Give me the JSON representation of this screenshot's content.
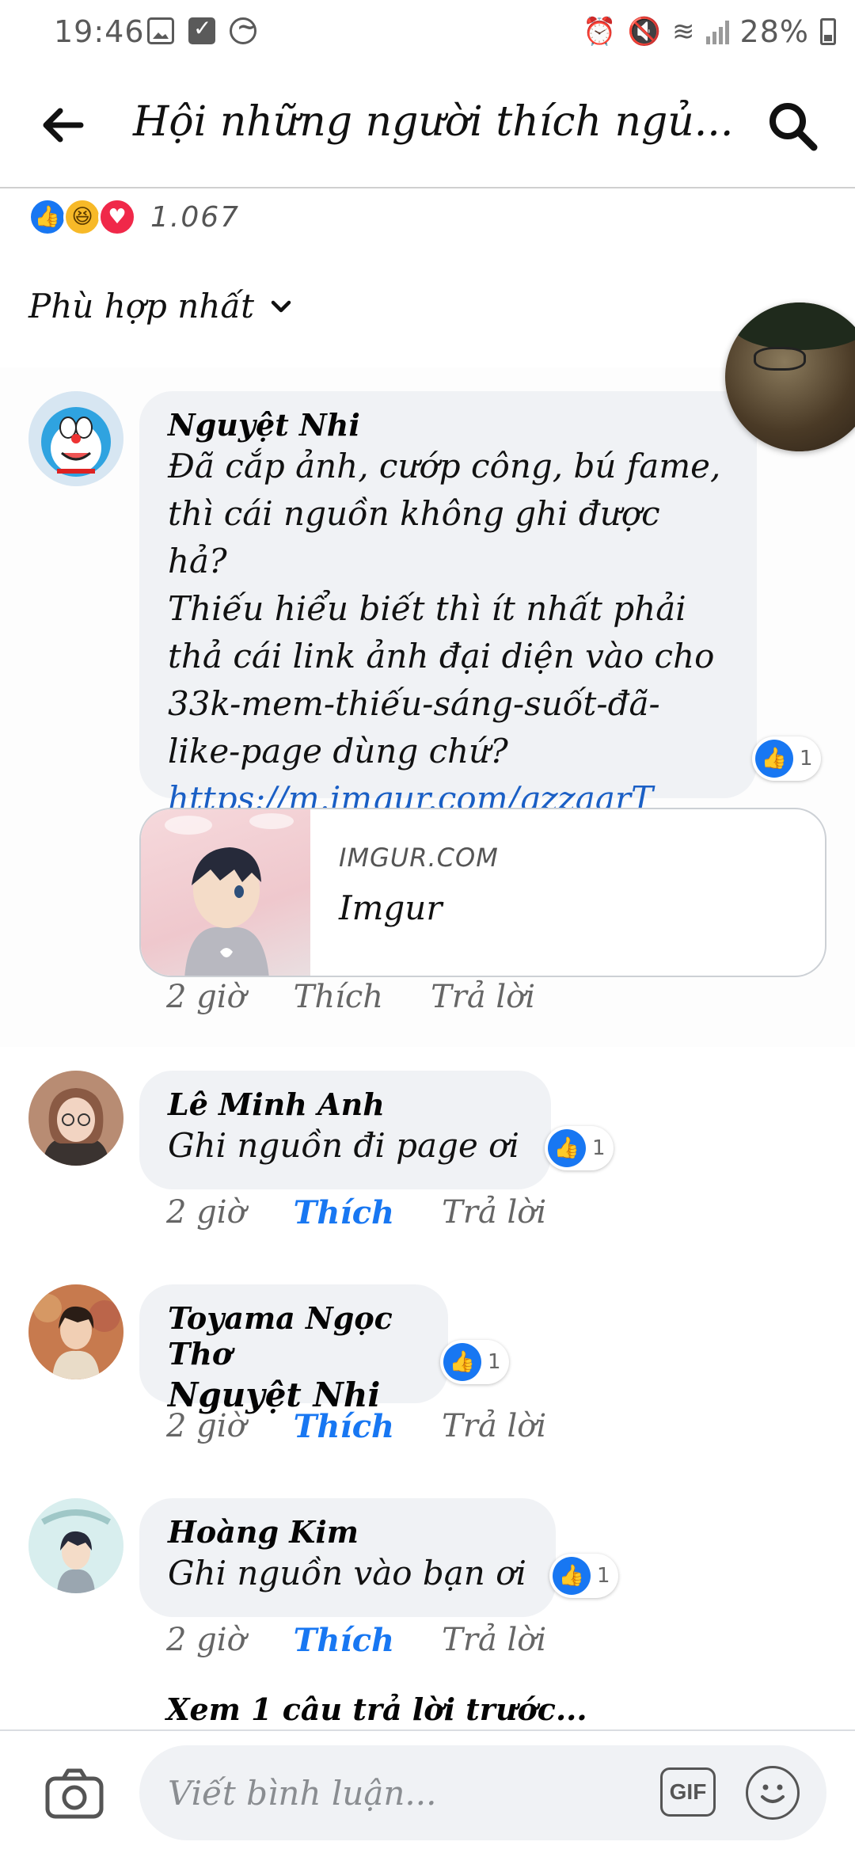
{
  "status_bar": {
    "time": "19:46",
    "battery": "28%"
  },
  "header": {
    "title": "Hội những người thích ngủ..."
  },
  "reactions": {
    "count": "1.067"
  },
  "sort": {
    "label": "Phù hợp nhất"
  },
  "comments": [
    {
      "author": "Nguyệt Nhi",
      "text_lines": [
        "Đã cắp ảnh, cướp công, bú fame,",
        "thì cái nguồn không ghi được hả?",
        "Thiếu hiểu biết thì ít nhất phải",
        "thả cái link ảnh đại diện vào cho",
        "33k-mem-thiếu-sáng-suốt-đã-",
        "like-page dùng chứ?"
      ],
      "link": "https://m.imgur.com/gzzaarT",
      "likes": "1",
      "time": "2 giờ",
      "like_label": "Thích",
      "reply_label": "Trả lời",
      "link_preview": {
        "domain": "IMGUR.COM",
        "title": "Imgur"
      }
    },
    {
      "author": "Lê Minh Anh",
      "text": "Ghi nguồn đi page ơi",
      "likes": "1",
      "time": "2 giờ",
      "like_label": "Thích",
      "reply_label": "Trả lời"
    },
    {
      "author": "Toyama Ngọc Thơ",
      "text": "Nguyệt Nhi",
      "likes": "1",
      "time": "2 giờ",
      "like_label": "Thích",
      "reply_label": "Trả lời"
    },
    {
      "author": "Hoàng Kim",
      "text": "Ghi nguồn vào bạn ơi",
      "likes": "1",
      "time": "2 giờ",
      "like_label": "Thích",
      "reply_label": "Trả lời"
    }
  ],
  "more_replies": "Xem 1 câu trả lời trước...",
  "composer": {
    "placeholder": "Viết bình luận...",
    "gif_label": "GIF"
  },
  "colors": {
    "accent": "#1877f2",
    "link": "#1a5fc5",
    "bubble": "#f0f2f5"
  },
  "icons": [
    "back-arrow-icon",
    "search-icon",
    "like-reaction-icon",
    "haha-reaction-icon",
    "love-reaction-icon",
    "chevron-down-icon",
    "camera-icon",
    "gif-icon",
    "emoji-icon"
  ]
}
